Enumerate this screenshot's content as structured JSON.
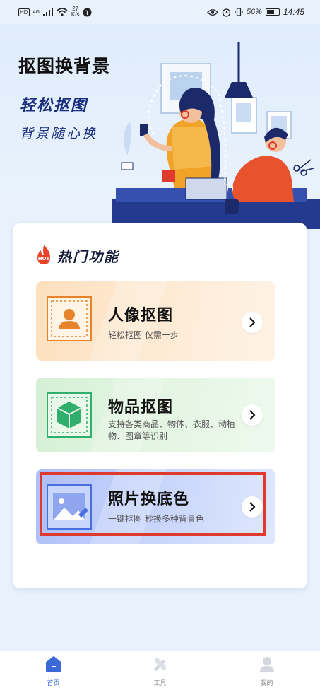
{
  "status_bar": {
    "hd": "HD",
    "network": "4G",
    "speed_value": "27",
    "speed_unit": "K/s",
    "battery": "56%",
    "time": "14:45"
  },
  "hero": {
    "title": "抠图换背景",
    "subtitle_1": "轻松抠图",
    "subtitle_2": "背景随心换"
  },
  "hot": {
    "badge": "HOT",
    "title": "热门功能",
    "features": [
      {
        "title": "人像抠图",
        "desc": "轻松抠图 仅需一步",
        "icon": "portrait-icon"
      },
      {
        "title": "物品抠图",
        "desc": "支持各类商品、物体、衣服、动植物、图章等识别",
        "icon": "box-icon"
      },
      {
        "title": "照片换底色",
        "desc": "一键抠图 秒换多种背景色",
        "icon": "image-icon"
      }
    ]
  },
  "nav": {
    "items": [
      {
        "label": "首页",
        "icon": "home-icon",
        "active": true
      },
      {
        "label": "工具",
        "icon": "tools-icon",
        "active": false
      },
      {
        "label": "我的",
        "icon": "user-icon",
        "active": false
      }
    ]
  },
  "colors": {
    "accent": "#3b6ad8",
    "highlight": "#e03a2e",
    "navy": "#1a2e80"
  }
}
